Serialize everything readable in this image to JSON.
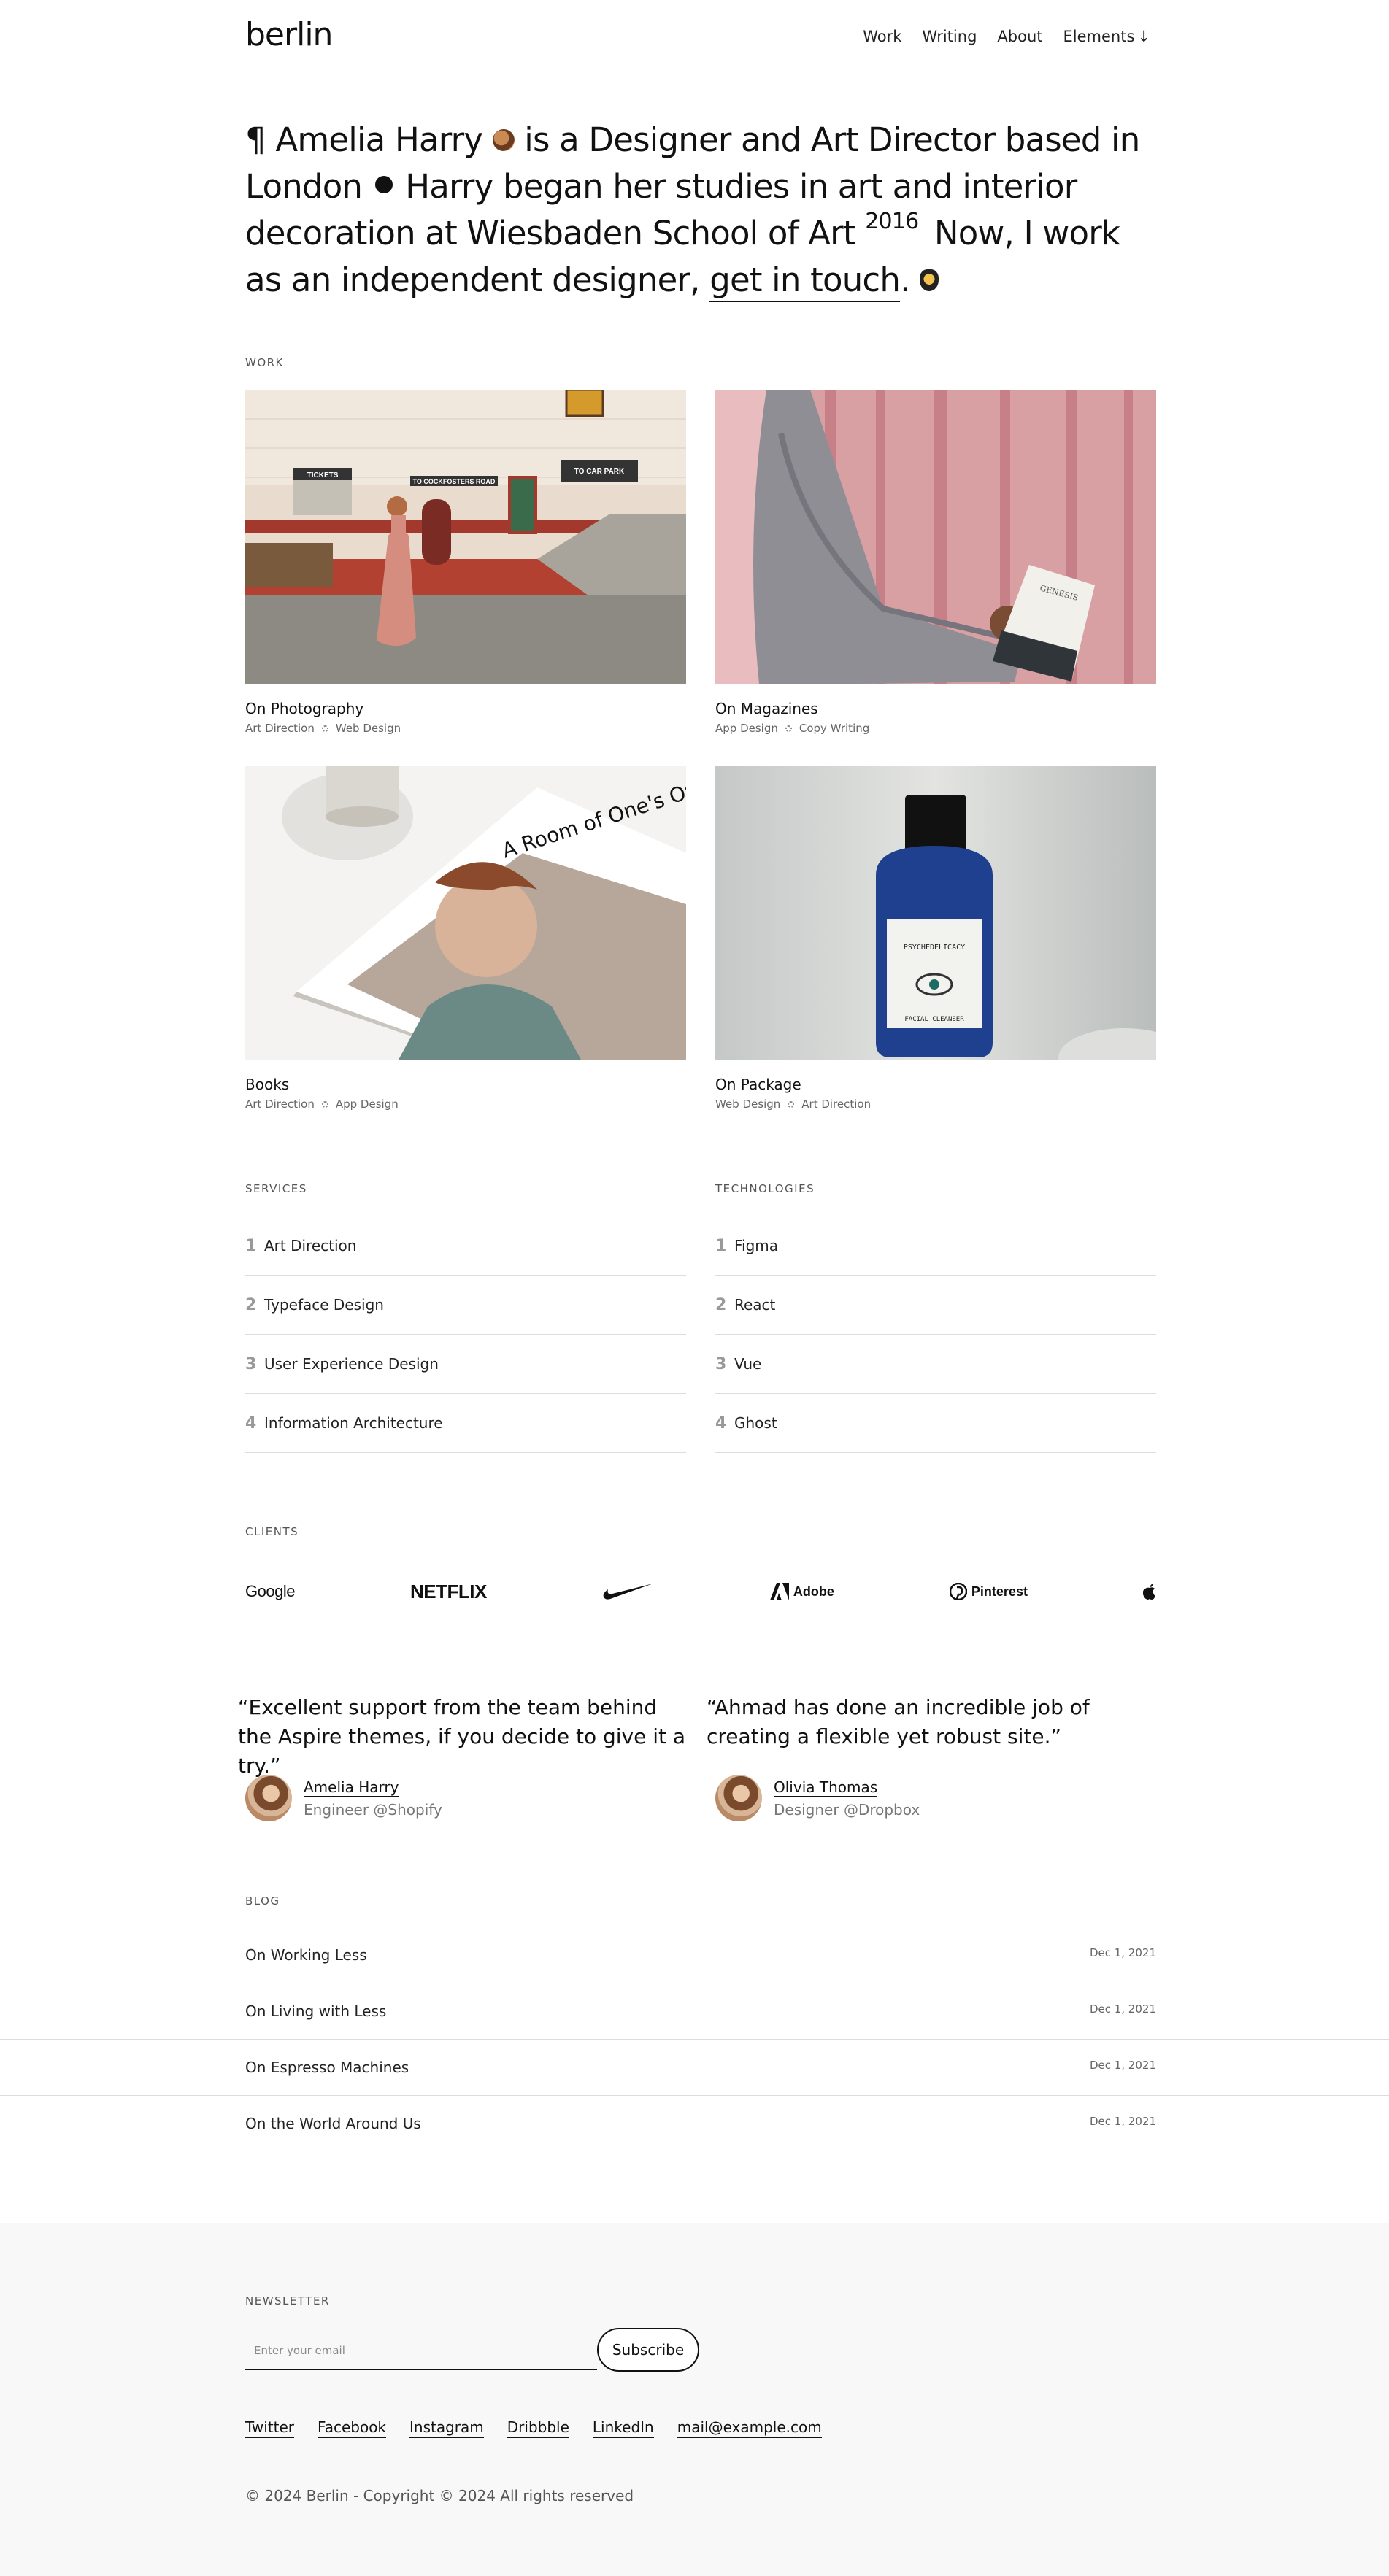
{
  "header": {
    "logo": "berlin",
    "nav": [
      "Work",
      "Writing",
      "About",
      "Elements"
    ],
    "nav_arrow": "↓"
  },
  "hero": {
    "pilcrow": "¶",
    "name": "Amelia Harry",
    "line1": " is a Designer and Art Director based in London",
    "line2": "Harry began her studies in art and interior decoration at Wiesbaden School of Art",
    "year": "2016",
    "line3": "Now, I work as an independent designer,",
    "link": "get in touch",
    "period": "."
  },
  "work": {
    "label": "Work",
    "items": [
      {
        "title": "On Photography",
        "tags": [
          "Art Direction",
          "Web Design"
        ]
      },
      {
        "title": "On Magazines",
        "tags": [
          "App Design",
          "Copy Writing"
        ]
      },
      {
        "title": "Books",
        "tags": [
          "Art Direction",
          "App Design"
        ]
      },
      {
        "title": "On Package",
        "tags": [
          "Web Design",
          "Art Direction"
        ]
      }
    ],
    "image_text": {
      "tickets": "TICKETS",
      "cockfosters": "TO COCKFOSTERS ROAD",
      "carpark": "TO CAR PARK",
      "genesis": "GENESIS",
      "book": "A Room of One's Own",
      "bottle_brand": "PSYCHEDELICACY",
      "bottle_sub": "FACIAL CLEANSER"
    }
  },
  "services": {
    "label": "Services",
    "items": [
      "Art Direction",
      "Typeface Design",
      "User Experience Design",
      "Information Architecture"
    ]
  },
  "technologies": {
    "label": "Technologies",
    "items": [
      "Figma",
      "React",
      "Vue",
      "Ghost"
    ]
  },
  "clients": {
    "label": "Clients",
    "logos": [
      "Google",
      "NETFLIX",
      "Adobe",
      "Pinterest"
    ]
  },
  "testimonials": [
    {
      "quote": "“Excellent support from the team behind the Aspire themes, if you decide to give it a try.”",
      "name": "Amelia Harry",
      "role": "Engineer @Shopify"
    },
    {
      "quote": "“Ahmad has done an incredible job of creating a flexible yet robust site.”",
      "name": "Olivia Thomas",
      "role": "Designer @Dropbox"
    }
  ],
  "blog": {
    "label": "Blog",
    "posts": [
      {
        "title": "On Working Less",
        "date": "Dec 1, 2021"
      },
      {
        "title": "On Living with Less",
        "date": "Dec 1, 2021"
      },
      {
        "title": "On Espresso Machines",
        "date": "Dec 1, 2021"
      },
      {
        "title": "On the World Around Us",
        "date": "Dec 1, 2021"
      }
    ]
  },
  "footer": {
    "newsletter_label": "Newsletter",
    "email_placeholder": "Enter your email",
    "subscribe": "Subscribe",
    "social": [
      "Twitter",
      "Facebook",
      "Instagram",
      "Dribbble",
      "LinkedIn",
      "mail@example.com"
    ],
    "copyright": "© 2024 Berlin - Copyright © 2024 All rights reserved"
  }
}
